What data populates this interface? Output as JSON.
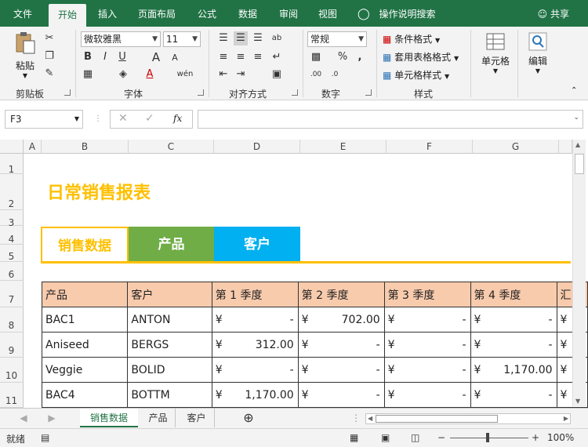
{
  "ribbon_tabs": [
    "文件",
    "开始",
    "插入",
    "页面布局",
    "公式",
    "数据",
    "审阅",
    "视图"
  ],
  "tell_me": "操作说明搜索",
  "share": "共享",
  "clipboard": {
    "paste": "粘贴",
    "group": "剪贴板"
  },
  "font": {
    "name": "微软雅黑",
    "size": "11",
    "group": "字体",
    "bold": "B",
    "italic": "I",
    "underline": "U",
    "grow": "A",
    "shrink": "A",
    "color_a": "A",
    "wen": "wén"
  },
  "alignment": {
    "group": "对齐方式"
  },
  "number": {
    "format": "常规",
    "group": "数字",
    "percent": "%",
    "comma": ","
  },
  "styles": {
    "conditional": "条件格式",
    "table_format": "套用表格格式",
    "cell_styles": "单元格样式",
    "group": "样式"
  },
  "cells": {
    "label": "单元格"
  },
  "editing": {
    "label": "编辑"
  },
  "name_box": "F3",
  "fx": "fx",
  "columns": [
    "A",
    "B",
    "C",
    "D",
    "E",
    "F",
    "G"
  ],
  "rows": [
    "1",
    "2",
    "3",
    "4",
    "5",
    "6",
    "7",
    "8",
    "9",
    "10",
    "11"
  ],
  "sheet_title": "日常销售报表",
  "section_tabs": [
    "销售数据",
    "产品",
    "客户"
  ],
  "table": {
    "headers": [
      "产品",
      "客户",
      "第 1 季度",
      "第 2 季度",
      "第 3 季度",
      "第 4 季度",
      "汇"
    ],
    "currency": "¥",
    "rows": [
      {
        "product": "BAC1",
        "customer": "ANTON",
        "q": [
          "-",
          "702.00",
          "-",
          "-"
        ]
      },
      {
        "product": "Aniseed",
        "customer": "BERGS",
        "q": [
          "312.00",
          "-",
          "-",
          "-"
        ]
      },
      {
        "product": "Veggie",
        "customer": "BOLID",
        "q": [
          "-",
          "-",
          "-",
          "1,170.00"
        ]
      },
      {
        "product": "BAC4",
        "customer": "BOTTM",
        "q": [
          "1,170.00",
          "-",
          "-",
          "-"
        ]
      }
    ]
  },
  "sheets": [
    "销售数据",
    "产品",
    "客户"
  ],
  "status": {
    "ready": "就绪",
    "zoom": "100%",
    "minus": "−",
    "plus": "+"
  },
  "colors": {
    "excel_green": "#217346",
    "title_yellow": "#ffc000",
    "tab_green": "#70ad47",
    "tab_blue": "#00b0f0",
    "header_peach": "#f8cbad"
  }
}
